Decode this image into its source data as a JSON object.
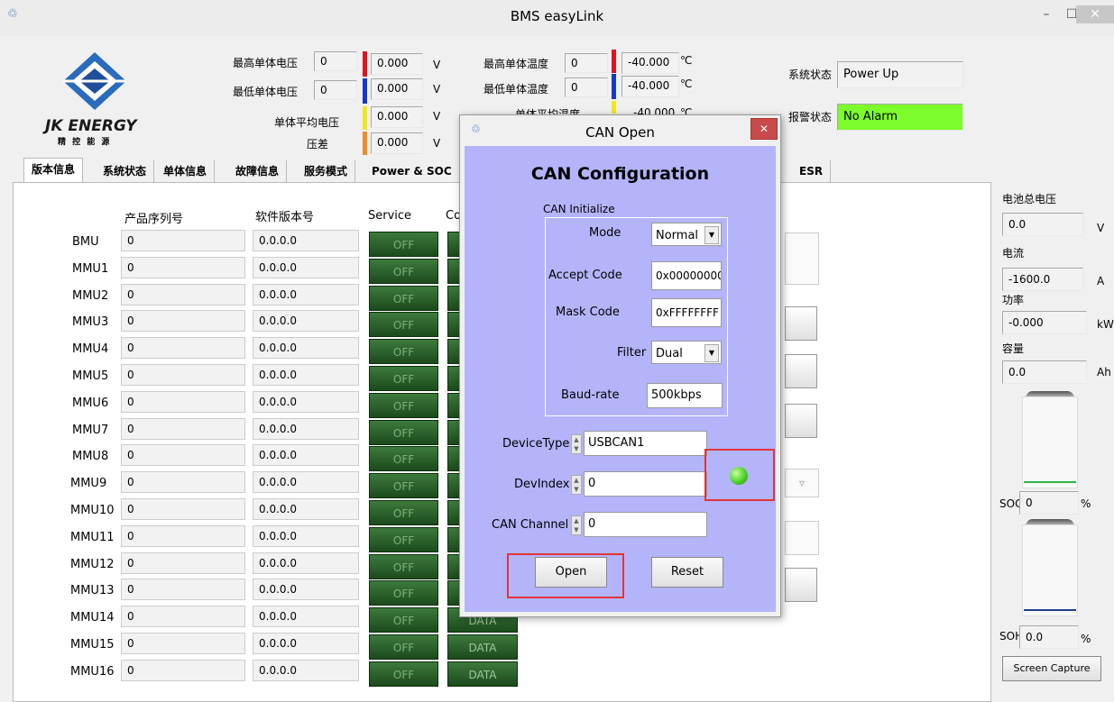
{
  "window": {
    "title": "BMS easyLink",
    "min": "–",
    "max": "☐",
    "close": "✕"
  },
  "logo": {
    "name": "JK ENERGY",
    "sub": "精 控 能 源"
  },
  "voltages": {
    "max_cell_label": "最高单体电压",
    "max_cell_num": "0",
    "max_cell_val": "0.000",
    "max_cell_unit": "V",
    "min_cell_label": "最低单体电压",
    "min_cell_num": "0",
    "min_cell_val": "0.000",
    "min_cell_unit": "V",
    "avg_label": "单体平均电压",
    "avg_val": "0.000",
    "avg_unit": "V",
    "diff_label": "压差",
    "diff_val": "0.000",
    "diff_unit": "V"
  },
  "temps": {
    "max_label": "最高单体温度",
    "max_num": "0",
    "max_val": "-40.000",
    "max_unit": "℃",
    "min_label": "最低单体温度",
    "min_num": "0",
    "min_val": "-40.000",
    "min_unit": "℃",
    "avg_label": "单体平均温度",
    "avg_val": "-40.000",
    "avg_unit": "℃"
  },
  "status": {
    "sys_label": "系统状态",
    "sys_val": "Power Up",
    "alarm_label": "报警状态",
    "alarm_val": "No Alarm"
  },
  "tabs": [
    "版本信息",
    "系统状态",
    "单体信息",
    "故障信息",
    "服务模式",
    "Power & SOC",
    "ESR"
  ],
  "table": {
    "headers": {
      "serial": "产品序列号",
      "software": "软件版本号",
      "service": "Service",
      "config": "Co"
    },
    "rows": [
      {
        "name": "BMU",
        "serial": "0",
        "sw": "0.0.0.0",
        "svc": "OFF"
      },
      {
        "name": "MMU1",
        "serial": "0",
        "sw": "0.0.0.0",
        "svc": "OFF"
      },
      {
        "name": "MMU2",
        "serial": "0",
        "sw": "0.0.0.0",
        "svc": "OFF"
      },
      {
        "name": "MMU3",
        "serial": "0",
        "sw": "0.0.0.0",
        "svc": "OFF"
      },
      {
        "name": "MMU4",
        "serial": "0",
        "sw": "0.0.0.0",
        "svc": "OFF"
      },
      {
        "name": "MMU5",
        "serial": "0",
        "sw": "0.0.0.0",
        "svc": "OFF"
      },
      {
        "name": "MMU6",
        "serial": "0",
        "sw": "0.0.0.0",
        "svc": "OFF"
      },
      {
        "name": "MMU7",
        "serial": "0",
        "sw": "0.0.0.0",
        "svc": "OFF"
      },
      {
        "name": "MMU8",
        "serial": "0",
        "sw": "0.0.0.0",
        "svc": "OFF"
      },
      {
        "name": "MMU9",
        "serial": "0",
        "sw": "0.0.0.0",
        "svc": "OFF"
      },
      {
        "name": "MMU10",
        "serial": "0",
        "sw": "0.0.0.0",
        "svc": "OFF"
      },
      {
        "name": "MMU11",
        "serial": "0",
        "sw": "0.0.0.0",
        "svc": "OFF"
      },
      {
        "name": "MMU12",
        "serial": "0",
        "sw": "0.0.0.0",
        "svc": "OFF"
      },
      {
        "name": "MMU13",
        "serial": "0",
        "sw": "0.0.0.0",
        "svc": "OFF"
      },
      {
        "name": "MMU14",
        "serial": "0",
        "sw": "0.0.0.0",
        "svc": "OFF",
        "data": "DATA"
      },
      {
        "name": "MMU15",
        "serial": "0",
        "sw": "0.0.0.0",
        "svc": "OFF",
        "data": "DATA"
      },
      {
        "name": "MMU16",
        "serial": "0",
        "sw": "0.0.0.0",
        "svc": "OFF",
        "data": "DATA"
      }
    ]
  },
  "right": {
    "total_v_label": "电池总电压",
    "total_v": "0.0",
    "total_v_unit": "V",
    "current_label": "电流",
    "current": "-1600.0",
    "current_unit": "A",
    "power_label": "功率",
    "power": "-0.000",
    "power_unit": "kW",
    "capacity_label": "容量",
    "capacity": "0.0",
    "capacity_unit": "Ah",
    "soc_label": "SOC",
    "soc": "0",
    "soc_unit": "%",
    "soh_label": "SOH",
    "soh": "0.0",
    "soh_unit": "%",
    "capture": "Screen Capture"
  },
  "dialog": {
    "title": "CAN Open",
    "heading": "CAN Configuration",
    "group": "CAN Initialize",
    "mode_label": "Mode",
    "mode": "Normal",
    "accept_label": "Accept Code",
    "accept": "0x00000000",
    "mask_label": "Mask Code",
    "mask": "0xFFFFFFFF",
    "filter_label": "Filter",
    "filter": "Dual",
    "baud_label": "Baud-rate",
    "baud": "500kbps",
    "devtype_label": "DeviceType",
    "devtype": "USBCAN1",
    "devindex_label": "DevIndex",
    "devindex": "0",
    "channel_label": "CAN Channel",
    "channel": "0",
    "open": "Open",
    "reset": "Reset"
  },
  "colors": {
    "max_bar": "#e0141e",
    "min_bar": "#1638c8",
    "avg_bar": "#f0e61e",
    "diff_bar": "#f08c28",
    "alarm_ok": "#7cfc2a",
    "dialog_bg": "#b4b4fb",
    "led": "#4cd12a"
  }
}
